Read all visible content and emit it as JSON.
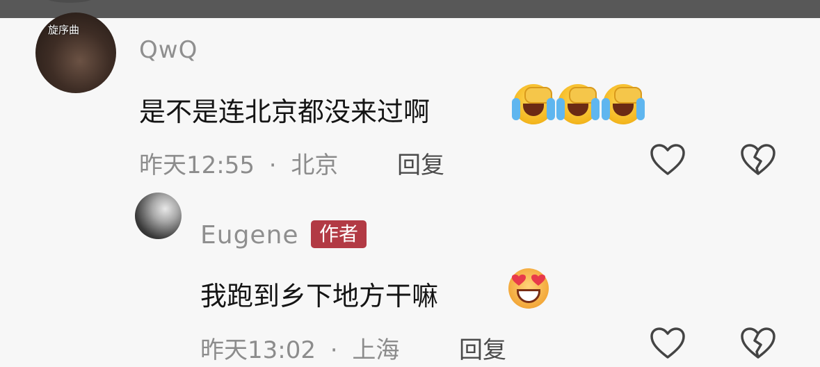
{
  "comments": [
    {
      "username": "QwQ",
      "avatar_caption": "旋序曲",
      "text": "是不是连北京都没来过啊",
      "emojis": [
        "cry-laugh-face-icon",
        "cry-laugh-face-icon",
        "cry-laugh-face-icon"
      ],
      "time": "昨天12:55",
      "separator": "·",
      "location": "北京",
      "reply_label": "回复"
    },
    {
      "username": "Eugene",
      "badge": "作者",
      "text": "我跑到乡下地方干嘛",
      "emojis": [
        "heart-eyes-face-icon"
      ],
      "time": "昨天13:02",
      "separator": "·",
      "location": "上海",
      "reply_label": "回复"
    }
  ],
  "colors": {
    "badge": "#b23a44",
    "text": "#141414",
    "muted": "#8c8c8c",
    "topbar": "#585858"
  }
}
